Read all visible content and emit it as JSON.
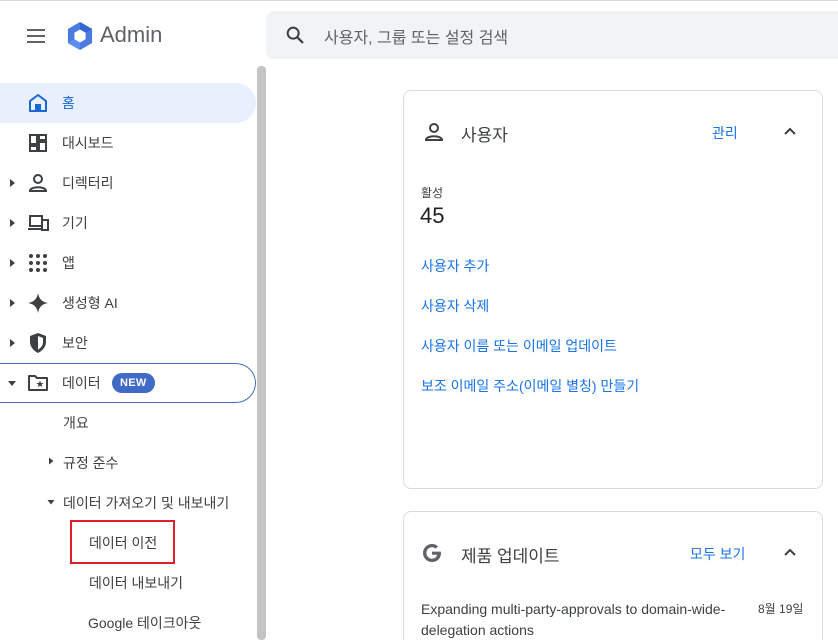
{
  "header": {
    "brand": "Admin",
    "search_placeholder": "사용자, 그룹 또는 설정 검색"
  },
  "sidebar": {
    "items": [
      {
        "label": "홈",
        "icon": "home-icon"
      },
      {
        "label": "대시보드",
        "icon": "dashboard-icon"
      },
      {
        "label": "디렉터리",
        "icon": "person-icon"
      },
      {
        "label": "기기",
        "icon": "devices-icon"
      },
      {
        "label": "앱",
        "icon": "apps-grid-icon"
      },
      {
        "label": "생성형 AI",
        "icon": "sparkle-icon"
      },
      {
        "label": "보안",
        "icon": "shield-icon"
      },
      {
        "label": "데이터",
        "icon": "folder-star-icon",
        "badge": "NEW"
      }
    ],
    "data_children": {
      "overview": "개요",
      "compliance": "규정 준수",
      "import_export": "데이터 가져오기 및 내보내기",
      "migration": "데이터 이전",
      "export": "데이터 내보내기",
      "takeout": "Google 테이크아웃"
    }
  },
  "users_card": {
    "title": "사용자",
    "action": "관리",
    "stat_label": "활성",
    "stat_value": "45",
    "links": [
      "사용자 추가",
      "사용자 삭제",
      "사용자 이름 또는 이메일 업데이트",
      "보조 이메일 주소(이메일 별칭) 만들기"
    ]
  },
  "updates_card": {
    "title": "제품 업데이트",
    "action": "모두 보기",
    "items": [
      {
        "title": "Expanding multi-party-approvals to domain-wide-delegation actions",
        "date": "8월 19일"
      }
    ]
  },
  "colors": {
    "accent": "#1a73e8",
    "active_bg": "#e8f0fe",
    "badge": "#3f6ac6",
    "highlight": "#e0202a"
  }
}
